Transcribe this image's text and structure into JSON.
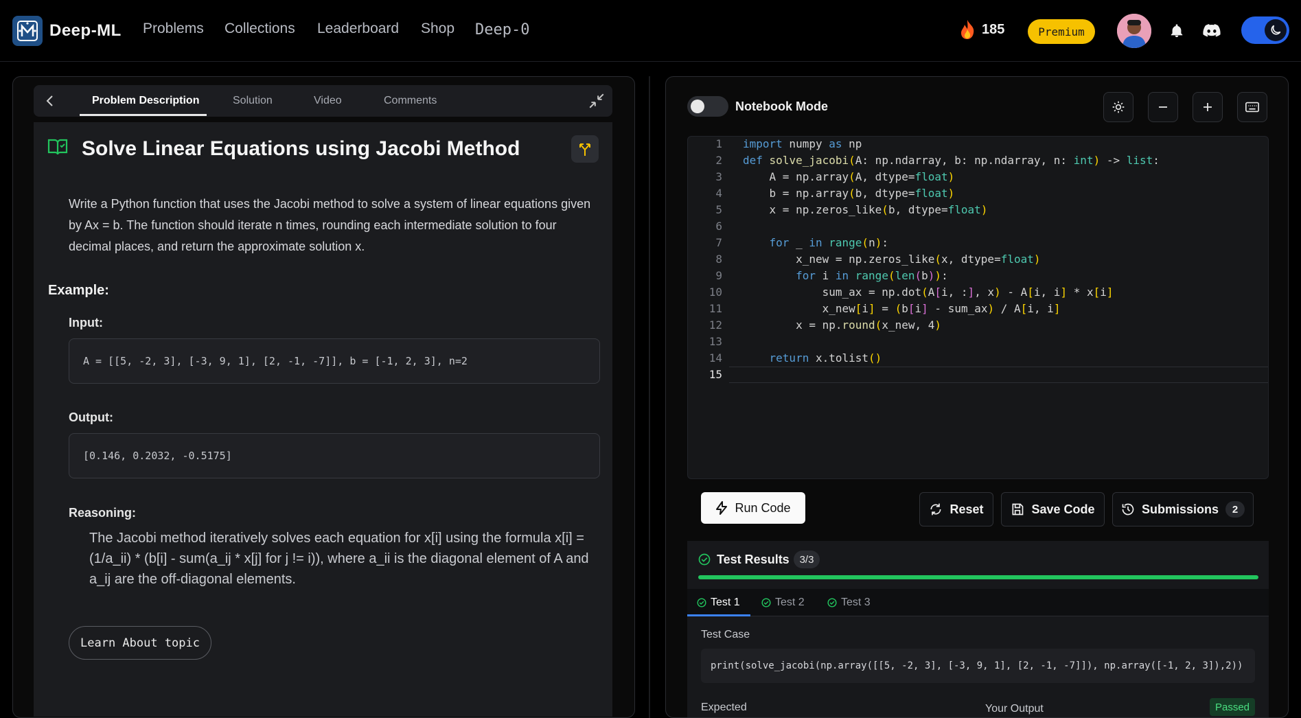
{
  "header": {
    "brand": "Deep-ML",
    "nav": [
      "Problems",
      "Collections",
      "Leaderboard",
      "Shop",
      "Deep-0"
    ],
    "streak": "185",
    "premium": "Premium"
  },
  "left": {
    "tabs": [
      "Problem Description",
      "Solution",
      "Video",
      "Comments"
    ],
    "title": "Solve Linear Equations using Jacobi Method",
    "description": "Write a Python function that uses the Jacobi method to solve a system of linear equations given by Ax = b. The function should iterate n times, rounding each intermediate solution to four decimal places, and return the approximate solution x.",
    "example_heading": "Example:",
    "input_label": "Input:",
    "input_value": "A = [[5, -2, 3], [-3, 9, 1], [2, -1, -7]], b = [-1, 2, 3], n=2",
    "output_label": "Output:",
    "output_value": "[0.146, 0.2032, -0.5175]",
    "reasoning_label": "Reasoning:",
    "reasoning": "The Jacobi method iteratively solves each equation for x[i] using the formula x[i] = (1/a_ii) * (b[i] - sum(a_ij * x[j] for j != i)), where a_ii is the diagonal element of A and a_ij are the off-diagonal elements.",
    "learn_button": "Learn About topic"
  },
  "right": {
    "notebook_label": "Notebook Mode",
    "line_numbers": [
      "1",
      "2",
      "3",
      "4",
      "5",
      "6",
      "7",
      "8",
      "9",
      "10",
      "11",
      "12",
      "13",
      "14",
      "15"
    ],
    "run_label": "Run Code",
    "reset_label": "Reset",
    "save_label": "Save Code",
    "submissions_label": "Submissions",
    "submissions_count": "2",
    "results_title": "Test Results",
    "results_count": "3/3",
    "progress_fraction": 1.0,
    "test_tabs": [
      "Test 1",
      "Test 2",
      "Test 3"
    ],
    "test_case_label": "Test Case",
    "test_case_code": "print(solve_jacobi(np.array([[5, -2, 3], [-3, 9, 1], [2, -1, -7]]), np.array([-1, 2, 3]),2))",
    "expected_label": "Expected",
    "your_output_label": "Your Output",
    "status": "Passed"
  },
  "colors": {
    "accent_blue": "#2563eb",
    "premium": "#f6c100",
    "success": "#22c55e"
  }
}
